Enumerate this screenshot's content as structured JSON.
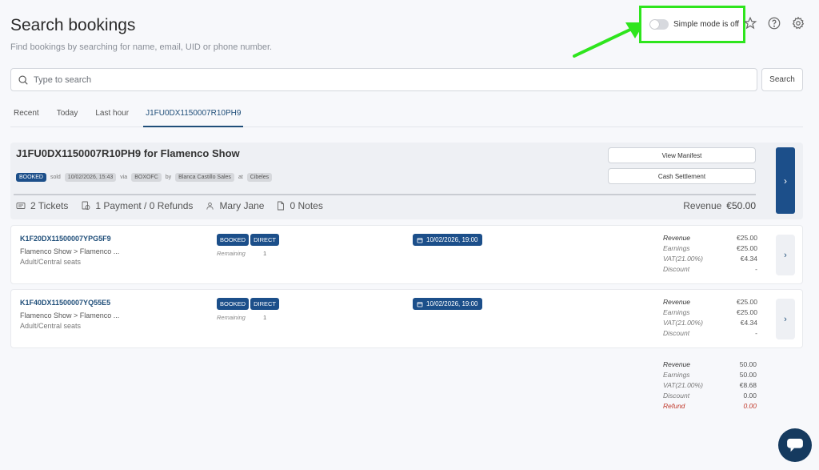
{
  "header": {
    "title": "Search bookings",
    "subtitle": "Find bookings by searching for name, email, UID or phone number.",
    "simple_mode_label": "Simple mode is off"
  },
  "search": {
    "placeholder": "Type to search",
    "button_label": "Search"
  },
  "tabs": [
    {
      "label": "Recent"
    },
    {
      "label": "Today"
    },
    {
      "label": "Last hour"
    },
    {
      "label": "J1FU0DX1150007R10PH9",
      "active": true
    }
  ],
  "order": {
    "title": "J1FU0DX1150007R10PH9 for Flamenco Show",
    "status": "BOOKED",
    "sold_label": "sold",
    "sold_date": "10/02/2026, 15:43",
    "via_label": "via",
    "channel": "BOXOFC",
    "by_label": "by",
    "seller": "Blanca Castillo Sales",
    "at_label": "at",
    "location": "Cibeles",
    "view_manifest_label": "View Manifest",
    "cash_settlement_label": "Cash Settlement",
    "tickets": "2 Tickets",
    "payments": "1 Payment / 0 Refunds",
    "customer": "Mary Jane",
    "notes": "0 Notes",
    "revenue_label": "Revenue",
    "revenue_value": "€50.00"
  },
  "tickets": [
    {
      "id": "K1F20DX11500007YPG5F9",
      "name": "Flamenco Show > Flamenco ...",
      "seat": "Adult/Central seats",
      "badge1": "BOOKED",
      "badge2": "DIRECT",
      "remaining_label": "Remaining",
      "remaining_value": "1",
      "date": "10/02/2026, 19:00",
      "revenue_label": "Revenue",
      "revenue": "€25.00",
      "earnings_label": "Earnings",
      "earnings": "€25.00",
      "vat_label": "VAT(21.00%)",
      "vat": "€4.34",
      "discount_label": "Discount",
      "discount": "-"
    },
    {
      "id": "K1F40DX11500007YQ55E5",
      "name": "Flamenco Show > Flamenco ...",
      "seat": "Adult/Central seats",
      "badge1": "BOOKED",
      "badge2": "DIRECT",
      "remaining_label": "Remaining",
      "remaining_value": "1",
      "date": "10/02/2026, 19:00",
      "revenue_label": "Revenue",
      "revenue": "€25.00",
      "earnings_label": "Earnings",
      "earnings": "€25.00",
      "vat_label": "VAT(21.00%)",
      "vat": "€4.34",
      "discount_label": "Discount",
      "discount": "-"
    }
  ],
  "totals": {
    "revenue_label": "Revenue",
    "revenue": "50.00",
    "earnings_label": "Earnings",
    "earnings": "50.00",
    "vat_label": "VAT(21.00%)",
    "vat": "€8.68",
    "discount_label": "Discount",
    "discount": "0.00",
    "refund_label": "Refund",
    "refund": "0.00"
  },
  "colors": {
    "primary": "#1c4f8a",
    "highlight": "#2ee51d",
    "refund": "#c0392b"
  },
  "icons": [
    "star-icon",
    "help-icon",
    "gear-icon",
    "search-icon",
    "ticket-icon",
    "payment-icon",
    "user-icon",
    "note-icon",
    "calendar-icon",
    "chevron-right-icon",
    "chat-icon"
  ]
}
